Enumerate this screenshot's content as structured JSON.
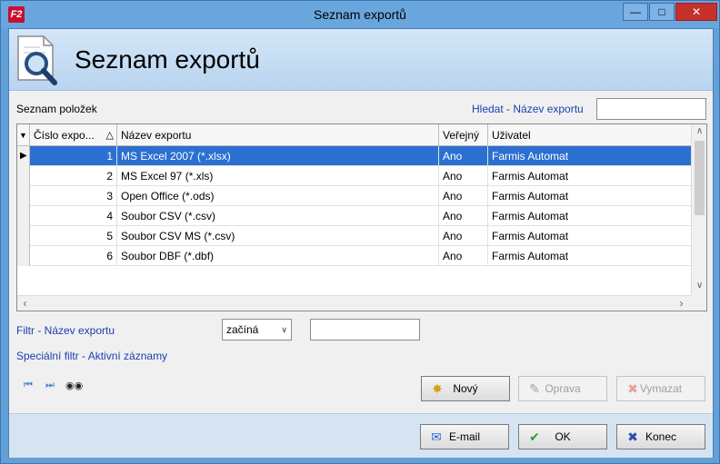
{
  "window": {
    "title": "Seznam exportů",
    "app_icon_text": "F2"
  },
  "header": {
    "title": "Seznam exportů"
  },
  "list": {
    "label": "Seznam položek",
    "search_label": "Hledat - Název exportu",
    "search_value": ""
  },
  "grid": {
    "columns": [
      "Číslo expo...",
      "Název exportu",
      "Veřejný",
      "Uživatel"
    ],
    "rows": [
      {
        "cislo": "1",
        "nazev": "MS Excel 2007 (*.xlsx)",
        "verejny": "Ano",
        "uzivatel": "Farmis Automat"
      },
      {
        "cislo": "2",
        "nazev": "MS Excel 97 (*.xls)",
        "verejny": "Ano",
        "uzivatel": "Farmis Automat"
      },
      {
        "cislo": "3",
        "nazev": "Open Office (*.ods)",
        "verejny": "Ano",
        "uzivatel": "Farmis Automat"
      },
      {
        "cislo": "4",
        "nazev": "Soubor CSV (*.csv)",
        "verejny": "Ano",
        "uzivatel": "Farmis Automat"
      },
      {
        "cislo": "5",
        "nazev": "Soubor CSV MS (*.csv)",
        "verejny": "Ano",
        "uzivatel": "Farmis Automat"
      },
      {
        "cislo": "6",
        "nazev": "Soubor DBF (*.dbf)",
        "verejny": "Ano",
        "uzivatel": "Farmis Automat"
      }
    ]
  },
  "filter": {
    "label": "Filtr - Název exportu",
    "mode": "začíná",
    "value": "",
    "special": "Speciální filtr - Aktivní záznamy"
  },
  "buttons": {
    "novy": "Nový",
    "oprava": "Oprava",
    "vymazat": "Vymazat",
    "email": "E-mail",
    "ok": "OK",
    "konec": "Konec"
  },
  "colors": {
    "selection": "#2b6fd1",
    "link": "#1a3fb0",
    "titlebar": "#6aa6de"
  }
}
